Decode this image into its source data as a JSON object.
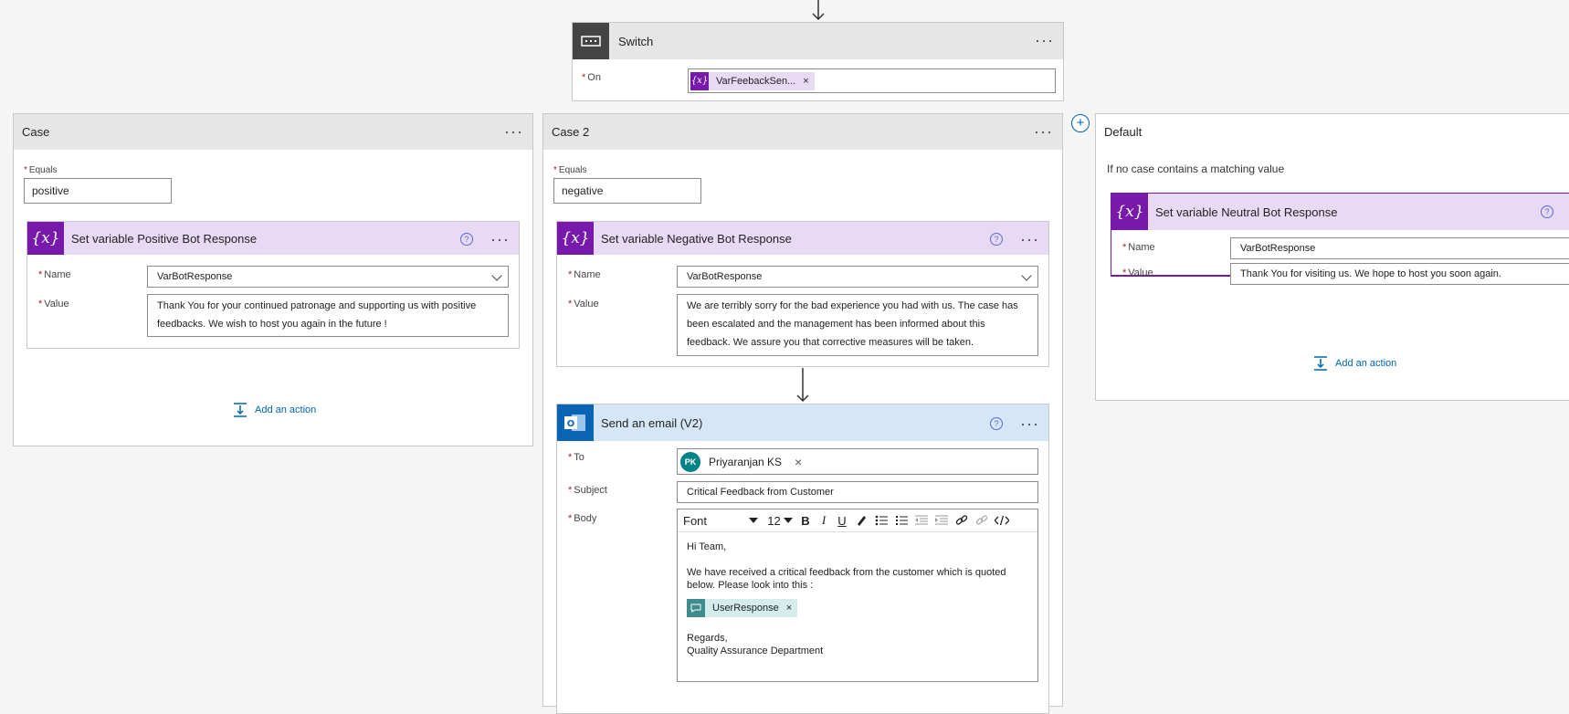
{
  "switch": {
    "title": "Switch",
    "on_label": "On",
    "on_token": "VarFeebackSen...",
    "token_remove": "×"
  },
  "cases": [
    {
      "title": "Case",
      "equals_label": "Equals",
      "equals_value": "positive",
      "action": {
        "title": "Set variable Positive Bot Response",
        "name_label": "Name",
        "name_value": "VarBotResponse",
        "value_label": "Value",
        "value_text": "Thank You for your continued patronage and supporting us with positive feedbacks. We wish to host you again in the future !"
      },
      "add_action": "Add an action"
    },
    {
      "title": "Case 2",
      "equals_label": "Equals",
      "equals_value": "negative",
      "action": {
        "title": "Set variable Negative Bot Response",
        "name_label": "Name",
        "name_value": "VarBotResponse",
        "value_label": "Value",
        "value_text": "We are terribly sorry for the bad experience you had with us. The case has been escalated and the management has been informed about this feedback. We assure you that corrective measures will be taken."
      }
    }
  ],
  "email": {
    "title": "Send an email (V2)",
    "to_label": "To",
    "to_initials": "PK",
    "to_name": "Priyaranjan KS",
    "to_remove": "×",
    "subject_label": "Subject",
    "subject_value": "Critical Feedback from Customer",
    "body_label": "Body",
    "toolbar": {
      "font": "Font",
      "size": "12",
      "bold": "B",
      "italic": "I",
      "underline": "U"
    },
    "body": {
      "line1": "Hi Team,",
      "line2": "We have received a critical feedback from the customer which is quoted below. Please look into this :",
      "token": "UserResponse",
      "token_remove": "×",
      "line3": "Regards,",
      "line4": "Quality Assurance Department"
    }
  },
  "default": {
    "title": "Default",
    "description": "If no case contains a matching value",
    "action": {
      "title": "Set variable Neutral Bot Response",
      "name_label": "Name",
      "name_value": "VarBotResponse",
      "value_label": "Value",
      "value_text": "Thank You for visiting us. We hope to host you soon again."
    },
    "add_action": "Add an action"
  },
  "icons": {
    "variable": "{x}",
    "more": "···",
    "help": "?",
    "add_case": "+"
  },
  "colors": {
    "variable_purple": "#7719aa",
    "variable_header": "#e8d9f5",
    "email_header": "#d5e7f7",
    "outlook_blue": "#0a64b4",
    "link_blue": "#0063b1",
    "required_red": "#a4262c"
  }
}
